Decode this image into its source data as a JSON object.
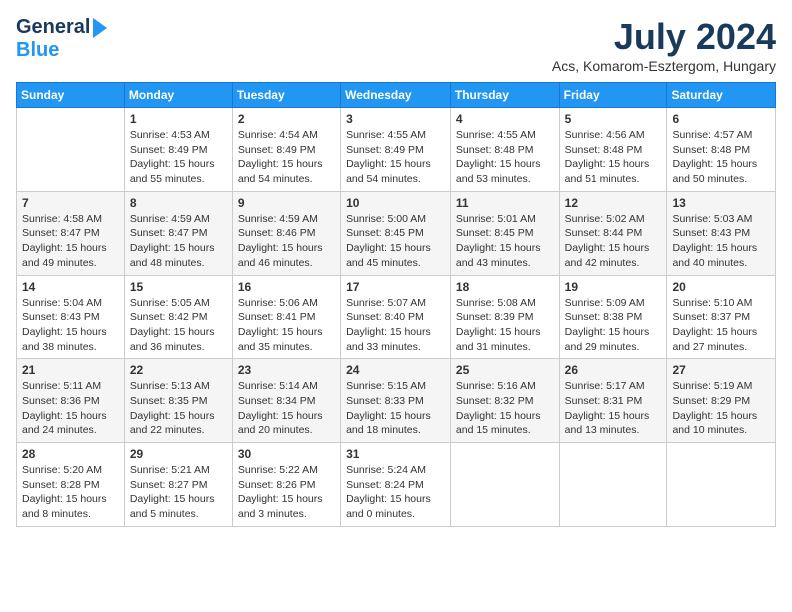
{
  "header": {
    "logo_general": "General",
    "logo_blue": "Blue",
    "main_title": "July 2024",
    "subtitle": "Acs, Komarom-Esztergom, Hungary"
  },
  "weekdays": [
    "Sunday",
    "Monday",
    "Tuesday",
    "Wednesday",
    "Thursday",
    "Friday",
    "Saturday"
  ],
  "weeks": [
    [
      {
        "day": "",
        "info": ""
      },
      {
        "day": "1",
        "info": "Sunrise: 4:53 AM\nSunset: 8:49 PM\nDaylight: 15 hours\nand 55 minutes."
      },
      {
        "day": "2",
        "info": "Sunrise: 4:54 AM\nSunset: 8:49 PM\nDaylight: 15 hours\nand 54 minutes."
      },
      {
        "day": "3",
        "info": "Sunrise: 4:55 AM\nSunset: 8:49 PM\nDaylight: 15 hours\nand 54 minutes."
      },
      {
        "day": "4",
        "info": "Sunrise: 4:55 AM\nSunset: 8:48 PM\nDaylight: 15 hours\nand 53 minutes."
      },
      {
        "day": "5",
        "info": "Sunrise: 4:56 AM\nSunset: 8:48 PM\nDaylight: 15 hours\nand 51 minutes."
      },
      {
        "day": "6",
        "info": "Sunrise: 4:57 AM\nSunset: 8:48 PM\nDaylight: 15 hours\nand 50 minutes."
      }
    ],
    [
      {
        "day": "7",
        "info": "Sunrise: 4:58 AM\nSunset: 8:47 PM\nDaylight: 15 hours\nand 49 minutes."
      },
      {
        "day": "8",
        "info": "Sunrise: 4:59 AM\nSunset: 8:47 PM\nDaylight: 15 hours\nand 48 minutes."
      },
      {
        "day": "9",
        "info": "Sunrise: 4:59 AM\nSunset: 8:46 PM\nDaylight: 15 hours\nand 46 minutes."
      },
      {
        "day": "10",
        "info": "Sunrise: 5:00 AM\nSunset: 8:45 PM\nDaylight: 15 hours\nand 45 minutes."
      },
      {
        "day": "11",
        "info": "Sunrise: 5:01 AM\nSunset: 8:45 PM\nDaylight: 15 hours\nand 43 minutes."
      },
      {
        "day": "12",
        "info": "Sunrise: 5:02 AM\nSunset: 8:44 PM\nDaylight: 15 hours\nand 42 minutes."
      },
      {
        "day": "13",
        "info": "Sunrise: 5:03 AM\nSunset: 8:43 PM\nDaylight: 15 hours\nand 40 minutes."
      }
    ],
    [
      {
        "day": "14",
        "info": "Sunrise: 5:04 AM\nSunset: 8:43 PM\nDaylight: 15 hours\nand 38 minutes."
      },
      {
        "day": "15",
        "info": "Sunrise: 5:05 AM\nSunset: 8:42 PM\nDaylight: 15 hours\nand 36 minutes."
      },
      {
        "day": "16",
        "info": "Sunrise: 5:06 AM\nSunset: 8:41 PM\nDaylight: 15 hours\nand 35 minutes."
      },
      {
        "day": "17",
        "info": "Sunrise: 5:07 AM\nSunset: 8:40 PM\nDaylight: 15 hours\nand 33 minutes."
      },
      {
        "day": "18",
        "info": "Sunrise: 5:08 AM\nSunset: 8:39 PM\nDaylight: 15 hours\nand 31 minutes."
      },
      {
        "day": "19",
        "info": "Sunrise: 5:09 AM\nSunset: 8:38 PM\nDaylight: 15 hours\nand 29 minutes."
      },
      {
        "day": "20",
        "info": "Sunrise: 5:10 AM\nSunset: 8:37 PM\nDaylight: 15 hours\nand 27 minutes."
      }
    ],
    [
      {
        "day": "21",
        "info": "Sunrise: 5:11 AM\nSunset: 8:36 PM\nDaylight: 15 hours\nand 24 minutes."
      },
      {
        "day": "22",
        "info": "Sunrise: 5:13 AM\nSunset: 8:35 PM\nDaylight: 15 hours\nand 22 minutes."
      },
      {
        "day": "23",
        "info": "Sunrise: 5:14 AM\nSunset: 8:34 PM\nDaylight: 15 hours\nand 20 minutes."
      },
      {
        "day": "24",
        "info": "Sunrise: 5:15 AM\nSunset: 8:33 PM\nDaylight: 15 hours\nand 18 minutes."
      },
      {
        "day": "25",
        "info": "Sunrise: 5:16 AM\nSunset: 8:32 PM\nDaylight: 15 hours\nand 15 minutes."
      },
      {
        "day": "26",
        "info": "Sunrise: 5:17 AM\nSunset: 8:31 PM\nDaylight: 15 hours\nand 13 minutes."
      },
      {
        "day": "27",
        "info": "Sunrise: 5:19 AM\nSunset: 8:29 PM\nDaylight: 15 hours\nand 10 minutes."
      }
    ],
    [
      {
        "day": "28",
        "info": "Sunrise: 5:20 AM\nSunset: 8:28 PM\nDaylight: 15 hours\nand 8 minutes."
      },
      {
        "day": "29",
        "info": "Sunrise: 5:21 AM\nSunset: 8:27 PM\nDaylight: 15 hours\nand 5 minutes."
      },
      {
        "day": "30",
        "info": "Sunrise: 5:22 AM\nSunset: 8:26 PM\nDaylight: 15 hours\nand 3 minutes."
      },
      {
        "day": "31",
        "info": "Sunrise: 5:24 AM\nSunset: 8:24 PM\nDaylight: 15 hours\nand 0 minutes."
      },
      {
        "day": "",
        "info": ""
      },
      {
        "day": "",
        "info": ""
      },
      {
        "day": "",
        "info": ""
      }
    ]
  ]
}
